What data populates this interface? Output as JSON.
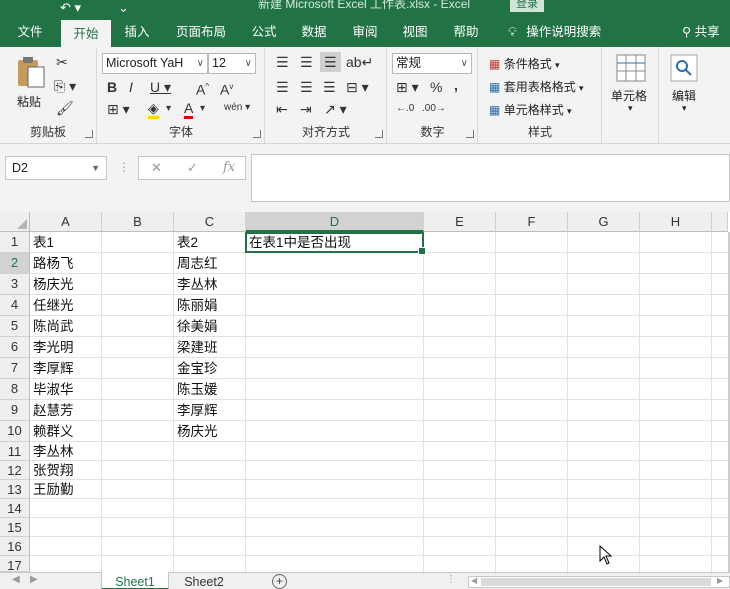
{
  "window": {
    "title": "新建 Microsoft Excel 工作表.xlsx  -  Excel",
    "login_label": "登录"
  },
  "ribbon_tabs": [
    {
      "label": "文件",
      "active": false
    },
    {
      "label": "开始",
      "active": true
    },
    {
      "label": "插入",
      "active": false
    },
    {
      "label": "页面布局",
      "active": false
    },
    {
      "label": "公式",
      "active": false
    },
    {
      "label": "数据",
      "active": false
    },
    {
      "label": "审阅",
      "active": false
    },
    {
      "label": "视图",
      "active": false
    },
    {
      "label": "帮助",
      "active": false
    }
  ],
  "tell_me": "操作说明搜索",
  "share": "共享",
  "ribbon": {
    "clipboard": {
      "paste": "粘贴",
      "label": "剪贴板"
    },
    "font": {
      "name": "Microsoft YaH",
      "size": "12",
      "label": "字体"
    },
    "alignment": {
      "label": "对齐方式"
    },
    "number": {
      "format": "常规",
      "label": "数字"
    },
    "styles": {
      "conditional": "条件格式",
      "table": "套用表格格式",
      "cell_styles": "单元格样式",
      "label": "样式"
    },
    "cells": {
      "label": "单元格"
    },
    "editing": {
      "label": "编辑"
    }
  },
  "formula_bar": {
    "name_box": "D2",
    "fx": "fx",
    "content": ""
  },
  "columns": [
    "A",
    "B",
    "C",
    "D",
    "E",
    "F",
    "G",
    "H"
  ],
  "selected_column": "D",
  "rows": [
    "1",
    "2",
    "3",
    "4",
    "5",
    "6",
    "7",
    "8",
    "9",
    "10",
    "11",
    "12",
    "13",
    "14",
    "15",
    "16",
    "17"
  ],
  "selected_row": "2",
  "cells": {
    "A": [
      "表1",
      "路杨飞",
      "杨庆光",
      "任继光",
      "陈尚武",
      "李光明",
      "李厚辉",
      "毕淑华",
      "赵慧芳",
      "赖群义",
      "李丛林",
      "张贺翔",
      "王励勤"
    ],
    "C": [
      "表2",
      "周志红",
      "李丛林",
      "陈丽娟",
      "徐美娟",
      "梁建班",
      "金宝珍",
      "陈玉媛",
      "李厚辉",
      "杨庆光"
    ],
    "D": [
      "在表1中是否出现"
    ]
  },
  "sheets": [
    {
      "label": "Sheet1",
      "active": true
    },
    {
      "label": "Sheet2",
      "active": false
    }
  ]
}
